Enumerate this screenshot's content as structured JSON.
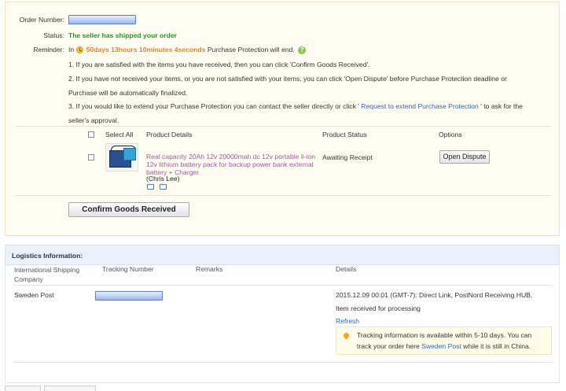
{
  "order": {
    "number_label": "Order Number:",
    "status_label": "Status:",
    "status_value": "The seller has shipped your order",
    "reminder_label": "Reminder:",
    "reminder_in": "In",
    "countdown": "50days 13hours 10minutes 4seconds",
    "reminder_tail": "Purchase Protection will end.",
    "help_glyph": "?",
    "note1": "1. If you are satisfied with the items you have received, then you can click 'Confirm Goods Received'.",
    "note2a": "2. If you have not received your items, or you are not satisfied with your items, you can click 'Open Dispute' before Purchase Protection deadline or",
    "note2b": "Purchase will be automatically finalized.",
    "note3a_pre": "3. If you would like to extend your Purchase Protection you can contact the seller directly or click '",
    "note3a_link": " Request to extend Purchase Protection ",
    "note3a_post": "' to ask for the",
    "note3b": "seller's approval."
  },
  "table": {
    "headers": {
      "select_all": "Select All",
      "product_details": "Product Details",
      "product_status": "Product Status",
      "options": "Options"
    },
    "item": {
      "title": "Real capacity 20Ah 12v 20000mah dc 12v portable li-ion 12v lithium battery pack for backup power bank external battery + Charger",
      "seller": "(Chris Lee)",
      "status": "Awaiting Receipt",
      "action": "Open Dispute"
    }
  },
  "confirm_button": "Confirm Goods Received",
  "logistics": {
    "title": "Logistics Information:",
    "headers": {
      "company": "International Shipping Company",
      "tracking": "Tracking Number",
      "remarks": "Remarks",
      "details": "Details"
    },
    "row": {
      "company": "Sweden Post",
      "details_line1": "2015.12.09 00:01 (GMT-7): Direct Link, PostNord Receiving HUB,",
      "details_line2": "Item received for processing",
      "refresh": "Refresh"
    },
    "tip": {
      "line1": "Tracking information is available within 5-10 days. You can",
      "line2_pre": "track your order here ",
      "line2_link": "Sweden Post",
      "line2_post": " while it is still in China."
    }
  },
  "colors": {
    "status_green": "#1f9a1f",
    "countdown_orange": "#d9822b",
    "link_blue": "#2b65b4",
    "panel_bg": "#fffdf2"
  },
  "icons": [
    "clock-icon",
    "help-icon",
    "product-thumbnail",
    "snapshot-icon",
    "chat-icon",
    "location-pin-icon"
  ]
}
